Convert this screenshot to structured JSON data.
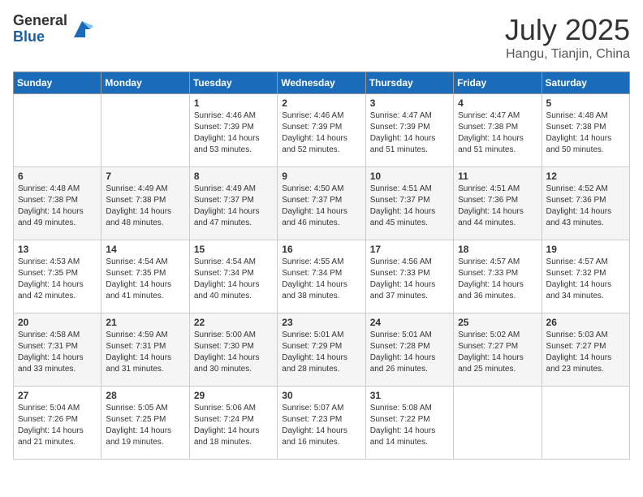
{
  "logo": {
    "general": "General",
    "blue": "Blue"
  },
  "calendar": {
    "title": "July 2025",
    "subtitle": "Hangu, Tianjin, China",
    "days_of_week": [
      "Sunday",
      "Monday",
      "Tuesday",
      "Wednesday",
      "Thursday",
      "Friday",
      "Saturday"
    ],
    "weeks": [
      [
        {
          "day": "",
          "sunrise": "",
          "sunset": "",
          "daylight": ""
        },
        {
          "day": "",
          "sunrise": "",
          "sunset": "",
          "daylight": ""
        },
        {
          "day": "1",
          "sunrise": "Sunrise: 4:46 AM",
          "sunset": "Sunset: 7:39 PM",
          "daylight": "Daylight: 14 hours and 53 minutes."
        },
        {
          "day": "2",
          "sunrise": "Sunrise: 4:46 AM",
          "sunset": "Sunset: 7:39 PM",
          "daylight": "Daylight: 14 hours and 52 minutes."
        },
        {
          "day": "3",
          "sunrise": "Sunrise: 4:47 AM",
          "sunset": "Sunset: 7:39 PM",
          "daylight": "Daylight: 14 hours and 51 minutes."
        },
        {
          "day": "4",
          "sunrise": "Sunrise: 4:47 AM",
          "sunset": "Sunset: 7:38 PM",
          "daylight": "Daylight: 14 hours and 51 minutes."
        },
        {
          "day": "5",
          "sunrise": "Sunrise: 4:48 AM",
          "sunset": "Sunset: 7:38 PM",
          "daylight": "Daylight: 14 hours and 50 minutes."
        }
      ],
      [
        {
          "day": "6",
          "sunrise": "Sunrise: 4:48 AM",
          "sunset": "Sunset: 7:38 PM",
          "daylight": "Daylight: 14 hours and 49 minutes."
        },
        {
          "day": "7",
          "sunrise": "Sunrise: 4:49 AM",
          "sunset": "Sunset: 7:38 PM",
          "daylight": "Daylight: 14 hours and 48 minutes."
        },
        {
          "day": "8",
          "sunrise": "Sunrise: 4:49 AM",
          "sunset": "Sunset: 7:37 PM",
          "daylight": "Daylight: 14 hours and 47 minutes."
        },
        {
          "day": "9",
          "sunrise": "Sunrise: 4:50 AM",
          "sunset": "Sunset: 7:37 PM",
          "daylight": "Daylight: 14 hours and 46 minutes."
        },
        {
          "day": "10",
          "sunrise": "Sunrise: 4:51 AM",
          "sunset": "Sunset: 7:37 PM",
          "daylight": "Daylight: 14 hours and 45 minutes."
        },
        {
          "day": "11",
          "sunrise": "Sunrise: 4:51 AM",
          "sunset": "Sunset: 7:36 PM",
          "daylight": "Daylight: 14 hours and 44 minutes."
        },
        {
          "day": "12",
          "sunrise": "Sunrise: 4:52 AM",
          "sunset": "Sunset: 7:36 PM",
          "daylight": "Daylight: 14 hours and 43 minutes."
        }
      ],
      [
        {
          "day": "13",
          "sunrise": "Sunrise: 4:53 AM",
          "sunset": "Sunset: 7:35 PM",
          "daylight": "Daylight: 14 hours and 42 minutes."
        },
        {
          "day": "14",
          "sunrise": "Sunrise: 4:54 AM",
          "sunset": "Sunset: 7:35 PM",
          "daylight": "Daylight: 14 hours and 41 minutes."
        },
        {
          "day": "15",
          "sunrise": "Sunrise: 4:54 AM",
          "sunset": "Sunset: 7:34 PM",
          "daylight": "Daylight: 14 hours and 40 minutes."
        },
        {
          "day": "16",
          "sunrise": "Sunrise: 4:55 AM",
          "sunset": "Sunset: 7:34 PM",
          "daylight": "Daylight: 14 hours and 38 minutes."
        },
        {
          "day": "17",
          "sunrise": "Sunrise: 4:56 AM",
          "sunset": "Sunset: 7:33 PM",
          "daylight": "Daylight: 14 hours and 37 minutes."
        },
        {
          "day": "18",
          "sunrise": "Sunrise: 4:57 AM",
          "sunset": "Sunset: 7:33 PM",
          "daylight": "Daylight: 14 hours and 36 minutes."
        },
        {
          "day": "19",
          "sunrise": "Sunrise: 4:57 AM",
          "sunset": "Sunset: 7:32 PM",
          "daylight": "Daylight: 14 hours and 34 minutes."
        }
      ],
      [
        {
          "day": "20",
          "sunrise": "Sunrise: 4:58 AM",
          "sunset": "Sunset: 7:31 PM",
          "daylight": "Daylight: 14 hours and 33 minutes."
        },
        {
          "day": "21",
          "sunrise": "Sunrise: 4:59 AM",
          "sunset": "Sunset: 7:31 PM",
          "daylight": "Daylight: 14 hours and 31 minutes."
        },
        {
          "day": "22",
          "sunrise": "Sunrise: 5:00 AM",
          "sunset": "Sunset: 7:30 PM",
          "daylight": "Daylight: 14 hours and 30 minutes."
        },
        {
          "day": "23",
          "sunrise": "Sunrise: 5:01 AM",
          "sunset": "Sunset: 7:29 PM",
          "daylight": "Daylight: 14 hours and 28 minutes."
        },
        {
          "day": "24",
          "sunrise": "Sunrise: 5:01 AM",
          "sunset": "Sunset: 7:28 PM",
          "daylight": "Daylight: 14 hours and 26 minutes."
        },
        {
          "day": "25",
          "sunrise": "Sunrise: 5:02 AM",
          "sunset": "Sunset: 7:27 PM",
          "daylight": "Daylight: 14 hours and 25 minutes."
        },
        {
          "day": "26",
          "sunrise": "Sunrise: 5:03 AM",
          "sunset": "Sunset: 7:27 PM",
          "daylight": "Daylight: 14 hours and 23 minutes."
        }
      ],
      [
        {
          "day": "27",
          "sunrise": "Sunrise: 5:04 AM",
          "sunset": "Sunset: 7:26 PM",
          "daylight": "Daylight: 14 hours and 21 minutes."
        },
        {
          "day": "28",
          "sunrise": "Sunrise: 5:05 AM",
          "sunset": "Sunset: 7:25 PM",
          "daylight": "Daylight: 14 hours and 19 minutes."
        },
        {
          "day": "29",
          "sunrise": "Sunrise: 5:06 AM",
          "sunset": "Sunset: 7:24 PM",
          "daylight": "Daylight: 14 hours and 18 minutes."
        },
        {
          "day": "30",
          "sunrise": "Sunrise: 5:07 AM",
          "sunset": "Sunset: 7:23 PM",
          "daylight": "Daylight: 14 hours and 16 minutes."
        },
        {
          "day": "31",
          "sunrise": "Sunrise: 5:08 AM",
          "sunset": "Sunset: 7:22 PM",
          "daylight": "Daylight: 14 hours and 14 minutes."
        },
        {
          "day": "",
          "sunrise": "",
          "sunset": "",
          "daylight": ""
        },
        {
          "day": "",
          "sunrise": "",
          "sunset": "",
          "daylight": ""
        }
      ]
    ]
  }
}
